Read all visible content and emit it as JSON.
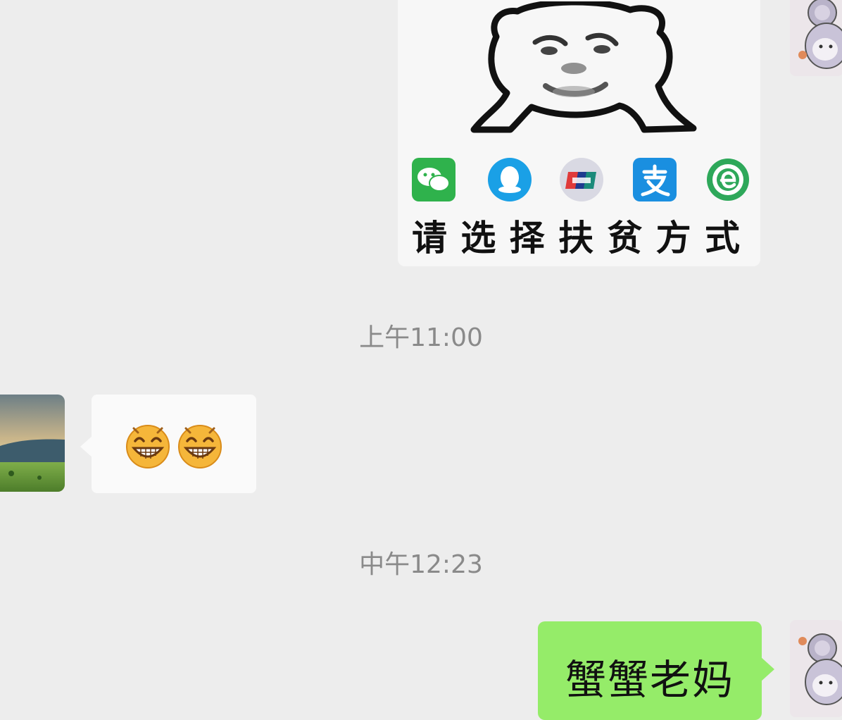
{
  "chat": {
    "messages": [
      {
        "sender": "me",
        "type": "sticker",
        "caption": "请选择扶贫方式",
        "payment_icons": [
          "wechat-icon",
          "qq-icon",
          "unionpay-icon",
          "alipay-icon",
          "e-payment-icon"
        ]
      },
      {
        "type": "timestamp",
        "text": "上午11:00"
      },
      {
        "sender": "friend",
        "type": "emoji",
        "emoji": [
          "grin-emoji",
          "grin-emoji"
        ]
      },
      {
        "type": "timestamp",
        "text": "中午12:23"
      },
      {
        "sender": "me",
        "type": "text",
        "text": "蟹蟹老妈"
      }
    ]
  },
  "colors": {
    "background": "#ededed",
    "outgoing_bubble": "#95ec69",
    "incoming_bubble": "#fafafa",
    "timestamp_text": "#8a8a8a"
  }
}
